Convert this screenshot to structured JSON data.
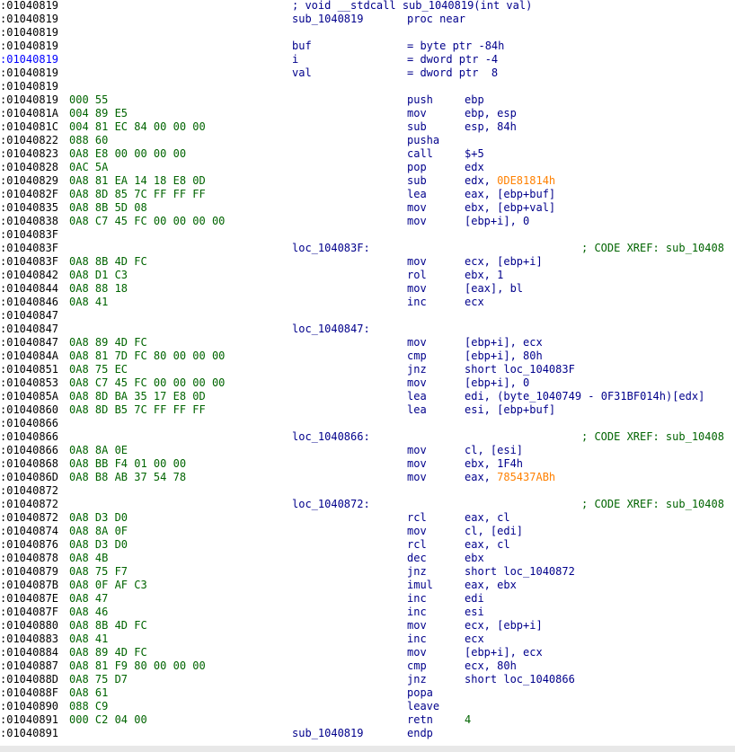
{
  "colors": {
    "address": "#000000",
    "address_highlight": "#0000ff",
    "bytes": "#006400",
    "instruction": "#00008b",
    "immediate": "#006400",
    "xref_comment": "#006400",
    "constant": "#ff8000"
  },
  "lines": [
    {
      "addr": ":01040819",
      "label": "; void __stdcall sub_1040819(int val)"
    },
    {
      "addr": ":01040819",
      "label": "sub_1040819",
      "mnem": "proc near"
    },
    {
      "addr": ":01040819"
    },
    {
      "addr": ":01040819",
      "label": "buf",
      "eq": "= byte ptr -84h"
    },
    {
      "addr": ":01040819",
      "label": "i",
      "eq": "= dword ptr -4",
      "addr_hl": true
    },
    {
      "addr": ":01040819",
      "label": "val",
      "eq": "= dword ptr  8"
    },
    {
      "addr": ":01040819"
    },
    {
      "addr": ":01040819",
      "bytes": "000 55",
      "mnem": "push",
      "ops": "ebp"
    },
    {
      "addr": ":0104081A",
      "bytes": "004 89 E5",
      "mnem": "mov",
      "ops": "ebp, esp"
    },
    {
      "addr": ":0104081C",
      "bytes": "004 81 EC 84 00 00 00",
      "mnem": "sub",
      "ops": "esp, 84h"
    },
    {
      "addr": ":01040822",
      "bytes": "088 60",
      "mnem": "pusha"
    },
    {
      "addr": ":01040823",
      "bytes": "0A8 E8 00 00 00 00",
      "mnem": "call",
      "ops": "$+5"
    },
    {
      "addr": ":01040828",
      "bytes": "0AC 5A",
      "mnem": "pop",
      "ops": "edx"
    },
    {
      "addr": ":01040829",
      "bytes": "0A8 81 EA 14 18 E8 0D",
      "mnem": "sub",
      "ops": "edx, ",
      "ops_const": "0DE81814h"
    },
    {
      "addr": ":0104082F",
      "bytes": "0A8 8D 85 7C FF FF FF",
      "mnem": "lea",
      "ops": "eax, [ebp+buf]"
    },
    {
      "addr": ":01040835",
      "bytes": "0A8 8B 5D 08",
      "mnem": "mov",
      "ops": "ebx, [ebp+val]"
    },
    {
      "addr": ":01040838",
      "bytes": "0A8 C7 45 FC 00 00 00 00",
      "mnem": "mov",
      "ops": "[ebp+i], 0"
    },
    {
      "addr": ":0104083F"
    },
    {
      "addr": ":0104083F",
      "label": "loc_104083F:",
      "cmt": "; CODE XREF: sub_10408"
    },
    {
      "addr": ":0104083F",
      "bytes": "0A8 8B 4D FC",
      "mnem": "mov",
      "ops": "ecx, [ebp+i]"
    },
    {
      "addr": ":01040842",
      "bytes": "0A8 D1 C3",
      "mnem": "rol",
      "ops": "ebx, 1"
    },
    {
      "addr": ":01040844",
      "bytes": "0A8 88 18",
      "mnem": "mov",
      "ops": "[eax], bl"
    },
    {
      "addr": ":01040846",
      "bytes": "0A8 41",
      "mnem": "inc",
      "ops": "ecx"
    },
    {
      "addr": ":01040847"
    },
    {
      "addr": ":01040847",
      "label": "loc_1040847:"
    },
    {
      "addr": ":01040847",
      "bytes": "0A8 89 4D FC",
      "mnem": "mov",
      "ops": "[ebp+i], ecx"
    },
    {
      "addr": ":0104084A",
      "bytes": "0A8 81 7D FC 80 00 00 00",
      "mnem": "cmp",
      "ops": "[ebp+i], 80h"
    },
    {
      "addr": ":01040851",
      "bytes": "0A8 75 EC",
      "mnem": "jnz",
      "ops": "short loc_104083F"
    },
    {
      "addr": ":01040853",
      "bytes": "0A8 C7 45 FC 00 00 00 00",
      "mnem": "mov",
      "ops": "[ebp+i], 0"
    },
    {
      "addr": ":0104085A",
      "bytes": "0A8 8D BA 35 17 E8 0D",
      "mnem": "lea",
      "ops": "edi, (byte_1040749 - 0F31BF014h)[edx]"
    },
    {
      "addr": ":01040860",
      "bytes": "0A8 8D B5 7C FF FF FF",
      "mnem": "lea",
      "ops": "esi, [ebp+buf]"
    },
    {
      "addr": ":01040866"
    },
    {
      "addr": ":01040866",
      "label": "loc_1040866:",
      "cmt": "; CODE XREF: sub_10408"
    },
    {
      "addr": ":01040866",
      "bytes": "0A8 8A 0E",
      "mnem": "mov",
      "ops": "cl, [esi]"
    },
    {
      "addr": ":01040868",
      "bytes": "0A8 BB F4 01 00 00",
      "mnem": "mov",
      "ops": "ebx, 1F4h"
    },
    {
      "addr": ":0104086D",
      "bytes": "0A8 B8 AB 37 54 78",
      "mnem": "mov",
      "ops": "eax, ",
      "ops_const": "785437ABh"
    },
    {
      "addr": ":01040872"
    },
    {
      "addr": ":01040872",
      "label": "loc_1040872:",
      "cmt": "; CODE XREF: sub_10408"
    },
    {
      "addr": ":01040872",
      "bytes": "0A8 D3 D0",
      "mnem": "rcl",
      "ops": "eax, cl"
    },
    {
      "addr": ":01040874",
      "bytes": "0A8 8A 0F",
      "mnem": "mov",
      "ops": "cl, [edi]"
    },
    {
      "addr": ":01040876",
      "bytes": "0A8 D3 D0",
      "mnem": "rcl",
      "ops": "eax, cl"
    },
    {
      "addr": ":01040878",
      "bytes": "0A8 4B",
      "mnem": "dec",
      "ops": "ebx"
    },
    {
      "addr": ":01040879",
      "bytes": "0A8 75 F7",
      "mnem": "jnz",
      "ops": "short loc_1040872"
    },
    {
      "addr": ":0104087B",
      "bytes": "0A8 0F AF C3",
      "mnem": "imul",
      "ops": "eax, ebx"
    },
    {
      "addr": ":0104087E",
      "bytes": "0A8 47",
      "mnem": "inc",
      "ops": "edi"
    },
    {
      "addr": ":0104087F",
      "bytes": "0A8 46",
      "mnem": "inc",
      "ops": "esi"
    },
    {
      "addr": ":01040880",
      "bytes": "0A8 8B 4D FC",
      "mnem": "mov",
      "ops": "ecx, [ebp+i]"
    },
    {
      "addr": ":01040883",
      "bytes": "0A8 41",
      "mnem": "inc",
      "ops": "ecx"
    },
    {
      "addr": ":01040884",
      "bytes": "0A8 89 4D FC",
      "mnem": "mov",
      "ops": "[ebp+i], ecx"
    },
    {
      "addr": ":01040887",
      "bytes": "0A8 81 F9 80 00 00 00",
      "mnem": "cmp",
      "ops": "ecx, 80h"
    },
    {
      "addr": ":0104088D",
      "bytes": "0A8 75 D7",
      "mnem": "jnz",
      "ops": "short loc_1040866"
    },
    {
      "addr": ":0104088F",
      "bytes": "0A8 61",
      "mnem": "popa"
    },
    {
      "addr": ":01040890",
      "bytes": "088 C9",
      "mnem": "leave"
    },
    {
      "addr": ":01040891",
      "bytes": "000 C2 04 00",
      "mnem": "retn",
      "ops": "4",
      "ops_green": true
    },
    {
      "addr": ":01040891",
      "label": "sub_1040819",
      "mnem": "endp"
    }
  ]
}
